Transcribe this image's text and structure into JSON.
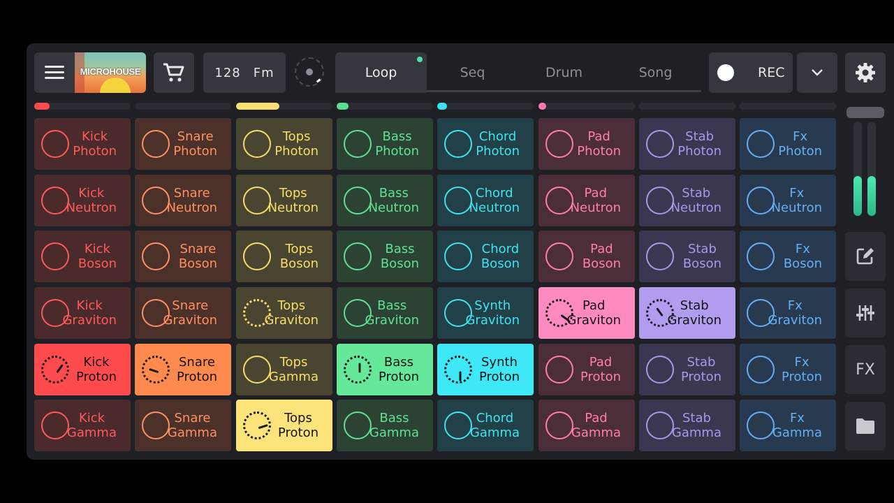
{
  "header": {
    "menu_icon": "hamburger-menu-icon",
    "cover_title": "MICROHOUSE",
    "cart_icon": "shopping-cart-icon",
    "tempo": "128",
    "key": "Fm",
    "dial_icon": "tempo-dial-icon",
    "tabs": [
      {
        "label": "Loop",
        "active": true
      },
      {
        "label": "Seq",
        "active": false
      },
      {
        "label": "Drum",
        "active": false
      },
      {
        "label": "Song",
        "active": false
      }
    ],
    "rec_label": "REC",
    "chevron_icon": "chevron-down-icon",
    "gear_icon": "gear-icon"
  },
  "channel_indicators": [
    {
      "color": "#ff4a50",
      "fill": 0.16
    },
    {
      "color": "#ff8a40",
      "fill": 0.0
    },
    {
      "color": "#f8e070",
      "fill": 0.45
    },
    {
      "color": "#58e090",
      "fill": 0.12
    },
    {
      "color": "#38e4f0",
      "fill": 0.1
    },
    {
      "color": "#ff78b0",
      "fill": 0.08
    },
    {
      "color": "#9a8ae0",
      "fill": 0.0
    },
    {
      "color": "#60a8f0",
      "fill": 0.0
    }
  ],
  "columns": [
    {
      "text": "#ff5a5a",
      "dim": "#4a2a2b",
      "bright": "#ff4a4e"
    },
    {
      "text": "#ff9060",
      "dim": "#4b3129",
      "bright": "#ff8a4e"
    },
    {
      "text": "#f6dd6a",
      "dim": "#4a4530",
      "bright": "#fde47a"
    },
    {
      "text": "#60e094",
      "dim": "#2c4334",
      "bright": "#66e89a"
    },
    {
      "text": "#40e2ee",
      "dim": "#224048",
      "bright": "#3ee8f6"
    },
    {
      "text": "#ff7cb0",
      "dim": "#4c2e3b",
      "bright": "#ff8ac0"
    },
    {
      "text": "#a898e8",
      "dim": "#3b3750",
      "bright": "#b29cf0"
    },
    {
      "text": "#66aef4",
      "dim": "#283a50",
      "bright": "#66aef4"
    }
  ],
  "pads": [
    [
      {
        "l1": "Kick",
        "l2": "Photon"
      },
      {
        "l1": "Snare",
        "l2": "Photon"
      },
      {
        "l1": "Tops",
        "l2": "Photon"
      },
      {
        "l1": "Bass",
        "l2": "Photon"
      },
      {
        "l1": "Chord",
        "l2": "Photon"
      },
      {
        "l1": "Pad",
        "l2": "Photon"
      },
      {
        "l1": "Stab",
        "l2": "Photon"
      },
      {
        "l1": "Fx",
        "l2": "Photon"
      }
    ],
    [
      {
        "l1": "Kick",
        "l2": "Neutron"
      },
      {
        "l1": "Snare",
        "l2": "Neutron"
      },
      {
        "l1": "Tops",
        "l2": "Neutron"
      },
      {
        "l1": "Bass",
        "l2": "Neutron"
      },
      {
        "l1": "Chord",
        "l2": "Neutron"
      },
      {
        "l1": "Pad",
        "l2": "Neutron"
      },
      {
        "l1": "Stab",
        "l2": "Neutron"
      },
      {
        "l1": "Fx",
        "l2": "Neutron"
      }
    ],
    [
      {
        "l1": "Kick",
        "l2": "Boson"
      },
      {
        "l1": "Snare",
        "l2": "Boson"
      },
      {
        "l1": "Tops",
        "l2": "Boson"
      },
      {
        "l1": "Bass",
        "l2": "Boson"
      },
      {
        "l1": "Chord",
        "l2": "Boson"
      },
      {
        "l1": "Pad",
        "l2": "Boson"
      },
      {
        "l1": "Stab",
        "l2": "Boson"
      },
      {
        "l1": "Fx",
        "l2": "Boson"
      }
    ],
    [
      {
        "l1": "Kick",
        "l2": "Graviton"
      },
      {
        "l1": "Snare",
        "l2": "Graviton"
      },
      {
        "l1": "Tops",
        "l2": "Graviton",
        "dash": true
      },
      {
        "l1": "Bass",
        "l2": "Graviton"
      },
      {
        "l1": "Synth",
        "l2": "Graviton"
      },
      {
        "l1": "Pad",
        "l2": "Graviton",
        "on": true,
        "pos": 0.35
      },
      {
        "l1": "Stab",
        "l2": "Graviton",
        "on": true,
        "pos": 0.9
      },
      {
        "l1": "Fx",
        "l2": "Graviton"
      }
    ],
    [
      {
        "l1": "Kick",
        "l2": "Proton",
        "on": true,
        "pos": 0.1
      },
      {
        "l1": "Snare",
        "l2": "Proton",
        "on": true,
        "pos": 0.8
      },
      {
        "l1": "Tops",
        "l2": "Gamma"
      },
      {
        "l1": "Bass",
        "l2": "Proton",
        "on": true,
        "pos": 0.0
      },
      {
        "l1": "Synth",
        "l2": "Proton",
        "on": true,
        "pos": 0.5
      },
      {
        "l1": "Pad",
        "l2": "Proton"
      },
      {
        "l1": "Stab",
        "l2": "Proton"
      },
      {
        "l1": "Fx",
        "l2": "Proton"
      }
    ],
    [
      {
        "l1": "Kick",
        "l2": "Gamma"
      },
      {
        "l1": "Snare",
        "l2": "Gamma"
      },
      {
        "l1": "Tops",
        "l2": "Proton",
        "on": true,
        "pos": 0.2
      },
      {
        "l1": "Bass",
        "l2": "Gamma"
      },
      {
        "l1": "Chord",
        "l2": "Gamma"
      },
      {
        "l1": "Pad",
        "l2": "Gamma"
      },
      {
        "l1": "Stab",
        "l2": "Gamma"
      },
      {
        "l1": "Fx",
        "l2": "Gamma"
      }
    ]
  ],
  "side": {
    "volume_levels": [
      0.42,
      0.42
    ],
    "edit_icon": "edit-pencil-icon",
    "mixer_icon": "mixer-sliders-icon",
    "fx_label": "FX",
    "folder_icon": "folder-icon"
  }
}
